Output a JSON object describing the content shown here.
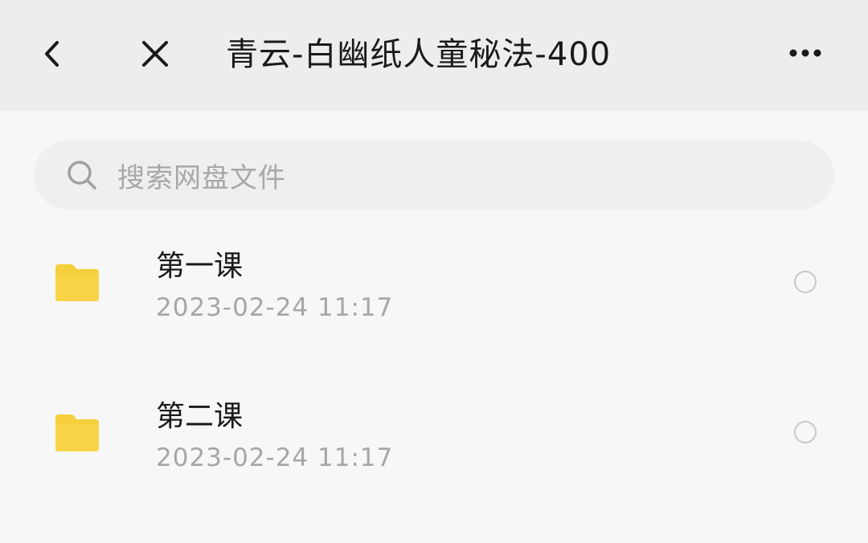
{
  "header": {
    "title": "青云-白幽纸人童秘法-400",
    "back_icon": "chevron-left-icon",
    "close_icon": "close-icon",
    "more_icon": "more-horizontal-icon"
  },
  "search": {
    "placeholder": "搜索网盘文件",
    "icon": "search-icon"
  },
  "files": [
    {
      "name": "第一课",
      "date": "2023-02-24  11:17",
      "type": "folder"
    },
    {
      "name": "第二课",
      "date": "2023-02-24  11:17",
      "type": "folder"
    }
  ],
  "colors": {
    "header_bg": "#ededed",
    "page_bg": "#f7f7f7",
    "folder": "#f5cf3c",
    "text_primary": "#1a1a1a",
    "text_secondary": "#a6a6a6"
  }
}
